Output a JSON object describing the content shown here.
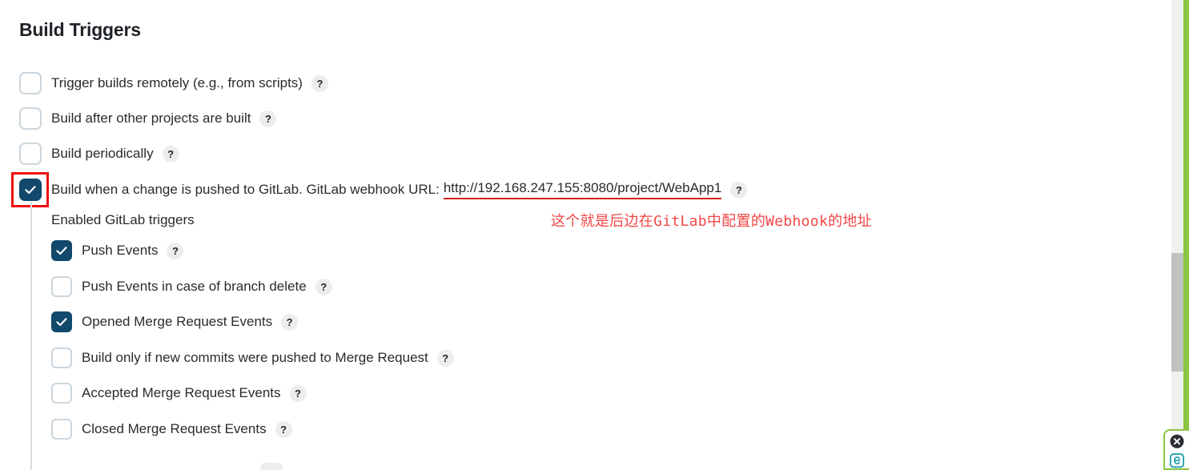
{
  "page": {
    "title": "Build Triggers",
    "help_glyph": "?"
  },
  "triggers": [
    {
      "label": "Trigger builds remotely (e.g., from scripts)",
      "checked": false,
      "help": "?"
    },
    {
      "label": "Build after other projects are built",
      "checked": false,
      "help": "?"
    },
    {
      "label": "Build periodically",
      "checked": false,
      "help": "?"
    },
    {
      "label": "Build when a change is pushed to GitLab. GitLab webhook URL:",
      "checked": true,
      "help": "?"
    }
  ],
  "webhook": {
    "url": "http://192.168.247.155:8080/project/WebApp1",
    "underline_color": "#d42020"
  },
  "annotation": {
    "text": "这个就是后边在GitLab中配置的Webhook的地址",
    "color": "#f24646",
    "box_color": "#ee1111"
  },
  "gitlab_group": {
    "caption": "Enabled GitLab triggers",
    "items": [
      {
        "label": "Push Events",
        "checked": true,
        "help": "?"
      },
      {
        "label": "Push Events in case of branch delete",
        "checked": false,
        "help": "?"
      },
      {
        "label": "Opened Merge Request Events",
        "checked": true,
        "help": "?"
      },
      {
        "label": "Build only if new commits were pushed to Merge Request",
        "checked": false,
        "help": "?"
      },
      {
        "label": "Accepted Merge Request Events",
        "checked": false,
        "help": "?"
      },
      {
        "label": "Closed Merge Request Events",
        "checked": false,
        "help": "?"
      }
    ]
  },
  "colors": {
    "checkbox_checked": "#11486b",
    "checkbox_border": "#ccd6dd",
    "accent_green": "#8cc540",
    "scrollbar_thumb": "#c1c1c1"
  },
  "corner_widget": {
    "close_icon": "close-circle-icon",
    "app_icon": "evernote-e-icon"
  }
}
